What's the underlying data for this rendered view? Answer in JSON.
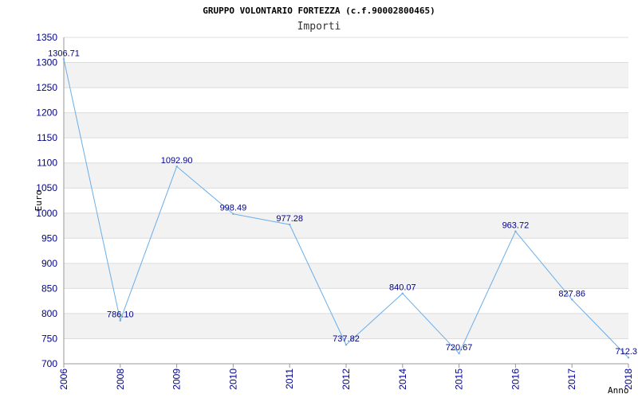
{
  "chart_data": {
    "type": "line",
    "title": "GRUPPO VOLONTARIO FORTEZZA (c.f.90002800465)",
    "subtitle": "Importi",
    "xlabel": "Anno",
    "ylabel": "Euro",
    "categories": [
      "2006",
      "2008",
      "2009",
      "2010",
      "2011",
      "2012",
      "2014",
      "2015",
      "2016",
      "2017",
      "2018"
    ],
    "series": [
      {
        "values": [
          1306.71,
          786.1,
          1092.9,
          998.49,
          977.28,
          737.82,
          840.07,
          720.67,
          963.72,
          827.86,
          712.3
        ],
        "labels": [
          "1306.71",
          "786.10",
          "1092.90",
          "998.49",
          "977.28",
          "737.82",
          "840.07",
          "720.67",
          "963.72",
          "827.86",
          "712.3"
        ]
      }
    ],
    "ylim": [
      700,
      1350
    ],
    "yticks": [
      700,
      750,
      800,
      850,
      900,
      950,
      1000,
      1050,
      1100,
      1150,
      1200,
      1250,
      1300,
      1350
    ],
    "grid": true,
    "colors": {
      "line": "#6aaee8",
      "band": "#f2f2f2",
      "gridline": "#dcdcdc",
      "axis": "#999999",
      "tick_text": "#00008b",
      "data_label_text": "#00008b"
    }
  }
}
